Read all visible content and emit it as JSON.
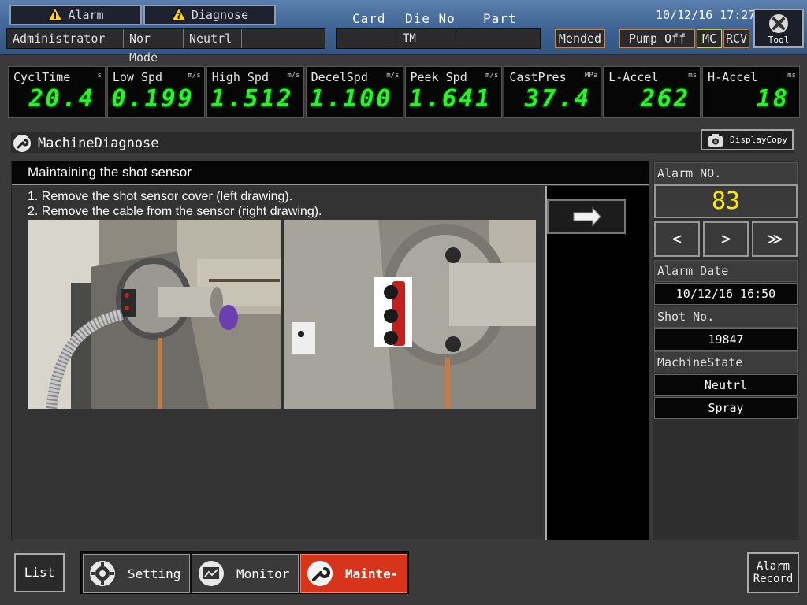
{
  "header": {
    "alarm_label": "Alarm",
    "diagnose_label": "Diagnose",
    "user": [
      "Administrator",
      "Nor Mode",
      "Neutrl",
      ""
    ],
    "card_label": "Card",
    "die_label": "Die No",
    "part_label": "Part",
    "card_value": "",
    "die_value": "TM",
    "part_value": "",
    "datetime": "10/12/16 17:27",
    "mended_label": "Mended",
    "pump_label": "Pump Off",
    "mc_label": "MC",
    "rcv_label": "RCV",
    "tool_label": "Tool"
  },
  "gauges": [
    {
      "label": "CyclTime",
      "unit": "s",
      "value": "20.4"
    },
    {
      "label": "Low Spd",
      "unit": "m/s",
      "value": "0.199"
    },
    {
      "label": "High Spd",
      "unit": "m/s",
      "value": "1.512"
    },
    {
      "label": "DecelSpd",
      "unit": "m/s",
      "value": "1.100"
    },
    {
      "label": "Peek Spd",
      "unit": "m/s",
      "value": "1.641"
    },
    {
      "label": "CastPres",
      "unit": "MPa",
      "value": "37.4"
    },
    {
      "label": "L-Accel",
      "unit": "ms",
      "value": "262"
    },
    {
      "label": "H-Accel",
      "unit": "ms",
      "value": "18"
    }
  ],
  "section": {
    "title": "MachineDiagnose",
    "display_copy": "DisplayCopy"
  },
  "main": {
    "title": "Maintaining the shot sensor",
    "step1": "1. Remove the shot sensor cover (left drawing).",
    "step2": "2. Remove the cable from the sensor (right drawing)."
  },
  "info": {
    "alarm_no_label": "Alarm NO.",
    "alarm_no": "83",
    "prev": "<",
    "next": ">",
    "last": "≫",
    "alarm_date_label": "Alarm Date",
    "alarm_date": "10/12/16 16:50",
    "shot_no_label": "Shot No.",
    "shot_no": "19847",
    "state_label": "MachineState",
    "state1": "Neutrl",
    "state2": "Spray"
  },
  "bottom": {
    "list": "List",
    "setting": "Setting",
    "monitor": "Monitor",
    "mainte": "Mainte-",
    "alarm_record_1": "Alarm",
    "alarm_record_2": "Record"
  },
  "colors": {
    "gauge_digits": "#2ef02e",
    "alarm_no": "#ffeb00",
    "active_tab": "#d8341c",
    "header_blue": "#3e6394"
  }
}
